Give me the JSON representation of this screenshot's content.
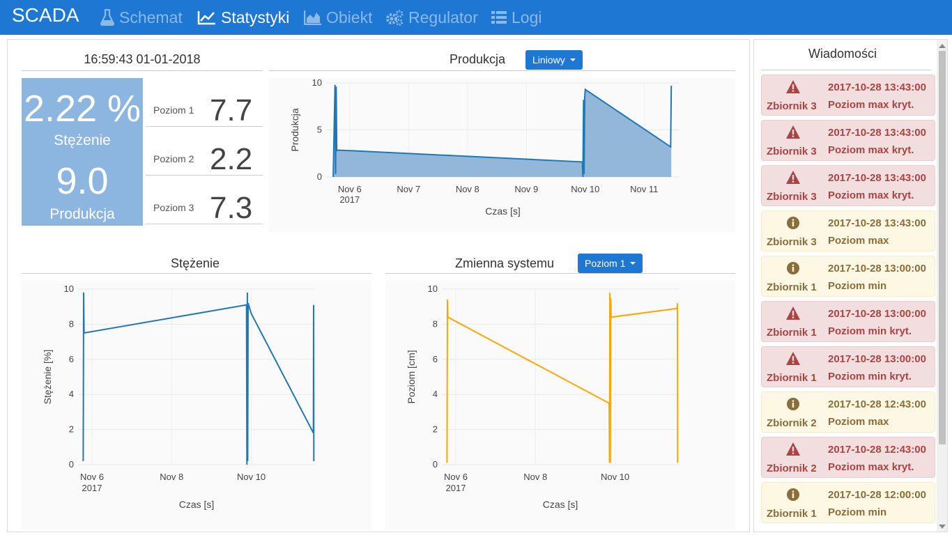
{
  "nav": {
    "brand": "SCADA",
    "items": [
      {
        "label": "Schemat",
        "icon": "flask-icon",
        "active": false
      },
      {
        "label": "Statystyki",
        "icon": "line-chart-icon",
        "active": true
      },
      {
        "label": "Obiekt",
        "icon": "area-chart-icon",
        "active": false
      },
      {
        "label": "Regulator",
        "icon": "gears-icon",
        "active": false
      },
      {
        "label": "Logi",
        "icon": "list-icon",
        "active": false
      }
    ]
  },
  "status": {
    "datetime": "16:59:43 01-01-2018",
    "concentration_value": "2.22 %",
    "concentration_label": "Stężenie",
    "production_value": "9.0",
    "production_label": "Produkcja",
    "levels": [
      {
        "label": "Poziom 1",
        "value": "7.7"
      },
      {
        "label": "Poziom 2",
        "value": "2.2"
      },
      {
        "label": "Poziom 3",
        "value": "7.3"
      }
    ]
  },
  "chart_data": [
    {
      "id": "produkcja",
      "type": "area",
      "title": "Produkcja",
      "control_label": "Liniowy",
      "xlabel": "Czas [s]",
      "ylabel": "Produkcja",
      "x_ticks": [
        "Nov 6",
        "Nov 7",
        "Nov 8",
        "Nov 9",
        "Nov 10",
        "Nov 11"
      ],
      "x_tick_year": "2017",
      "y_ticks": [
        "0",
        "5",
        "10"
      ],
      "ylim": [
        0,
        10
      ],
      "color": "#1f77b4",
      "fill": "#8db3d7",
      "x": [
        5.72,
        5.75,
        5.76,
        5.77,
        5.78,
        5.79,
        6.0,
        9.95,
        9.96,
        9.97,
        9.98,
        9.99,
        10.0,
        11.45,
        11.46
      ],
      "y": [
        0,
        9.8,
        0.3,
        9.6,
        2.8,
        2.85,
        2.8,
        1.6,
        0,
        8.2,
        0.3,
        8.5,
        9.3,
        3.2,
        9.7
      ]
    },
    {
      "id": "stezenie",
      "type": "line",
      "title": "Stężenie",
      "xlabel": "Czas [s]",
      "ylabel": "Stężenie [%]",
      "x_ticks": [
        "Nov 6",
        "Nov 8",
        "Nov 10"
      ],
      "x_tick_year": "2017",
      "y_ticks": [
        "0",
        "2",
        "4",
        "6",
        "8",
        "10"
      ],
      "ylim": [
        0,
        10
      ],
      "color": "#1f77b4",
      "x": [
        5.78,
        5.79,
        5.8,
        9.88,
        9.89,
        9.9,
        9.91,
        9.92,
        10.0,
        11.56,
        11.565,
        11.57
      ],
      "y": [
        0.2,
        9.8,
        7.5,
        9.1,
        0,
        9.8,
        0.2,
        9.2,
        8.6,
        1.8,
        9.1,
        0.2
      ]
    },
    {
      "id": "zmienna",
      "type": "line",
      "title": "Zmienna systemu",
      "control_label": "Poziom 1",
      "xlabel": "Czas [s]",
      "ylabel": "Poziom [cm]",
      "x_ticks": [
        "Nov 6",
        "Nov 8",
        "Nov 10"
      ],
      "x_tick_year": "2017",
      "y_ticks": [
        "0",
        "2",
        "4",
        "6",
        "8",
        "10"
      ],
      "ylim": [
        0,
        10
      ],
      "color": "#ffa500",
      "x": [
        5.78,
        5.79,
        5.8,
        9.85,
        9.86,
        9.87,
        9.88,
        9.89,
        9.9,
        11.56,
        11.565,
        11.57
      ],
      "y": [
        0.1,
        9.4,
        8.4,
        3.5,
        0.1,
        9.8,
        0.1,
        9.5,
        8.4,
        8.9,
        9.2,
        0.1
      ]
    }
  ],
  "messages": {
    "title": "Wiadomości",
    "items": [
      {
        "level": "danger",
        "source": "Zbiornik 3",
        "time": "2017-10-28 13:43:00",
        "text": "Poziom max kryt."
      },
      {
        "level": "danger",
        "source": "Zbiornik 3",
        "time": "2017-10-28 13:43:00",
        "text": "Poziom max kryt."
      },
      {
        "level": "danger",
        "source": "Zbiornik 3",
        "time": "2017-10-28 13:43:00",
        "text": "Poziom max kryt."
      },
      {
        "level": "warning",
        "source": "Zbiornik 3",
        "time": "2017-10-28 13:43:00",
        "text": "Poziom max"
      },
      {
        "level": "warning",
        "source": "Zbiornik 1",
        "time": "2017-10-28 13:00:00",
        "text": "Poziom min"
      },
      {
        "level": "danger",
        "source": "Zbiornik 1",
        "time": "2017-10-28 13:00:00",
        "text": "Poziom min kryt."
      },
      {
        "level": "danger",
        "source": "Zbiornik 1",
        "time": "2017-10-28 13:00:00",
        "text": "Poziom min kryt."
      },
      {
        "level": "warning",
        "source": "Zbiornik 2",
        "time": "2017-10-28 12:43:00",
        "text": "Poziom max"
      },
      {
        "level": "danger",
        "source": "Zbiornik 2",
        "time": "2017-10-28 12:43:00",
        "text": "Poziom max kryt."
      },
      {
        "level": "warning",
        "source": "Zbiornik 1",
        "time": "2017-10-28 12:00:00",
        "text": "Poziom min"
      }
    ]
  }
}
